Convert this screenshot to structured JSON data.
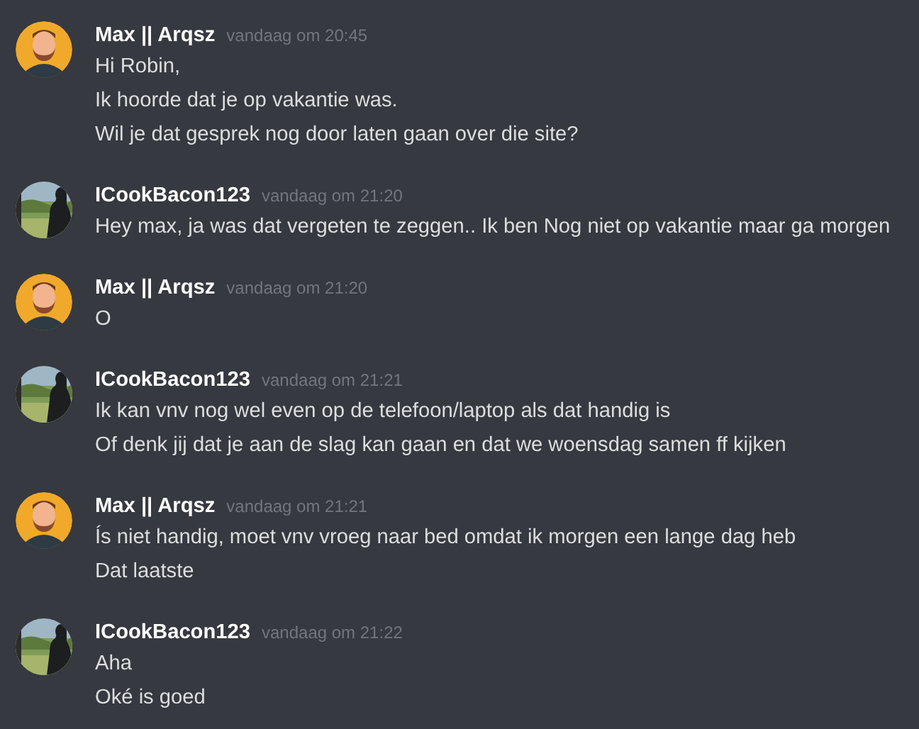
{
  "messages": [
    {
      "author": "Max || Arqsz",
      "avatar": {
        "kind": "cartoon"
      },
      "timestamp": "vandaag om 20:45",
      "lines": [
        "Hi Robin,",
        "Ik hoorde dat je op vakantie was.",
        "Wil je dat gesprek nog door laten gaan over die site?"
      ]
    },
    {
      "author": "ICookBacon123",
      "avatar": {
        "kind": "picture"
      },
      "timestamp": "vandaag om 21:20",
      "lines": [
        "Hey max, ja was dat vergeten te zeggen.. Ik ben Nog niet op vakantie maar ga morgen"
      ]
    },
    {
      "author": "Max || Arqsz",
      "avatar": {
        "kind": "cartoon"
      },
      "timestamp": "vandaag om 21:20",
      "lines": [
        "O"
      ]
    },
    {
      "author": "ICookBacon123",
      "avatar": {
        "kind": "picture"
      },
      "timestamp": "vandaag om 21:21",
      "lines": [
        "Ik kan vnv nog wel even op de telefoon/laptop als dat handig is",
        "Of denk jij dat je aan de slag kan gaan en dat we woensdag samen ff kijken"
      ]
    },
    {
      "author": "Max || Arqsz",
      "avatar": {
        "kind": "cartoon"
      },
      "timestamp": "vandaag om 21:21",
      "lines": [
        "Ís niet handig, moet vnv vroeg naar bed omdat ik morgen een lange dag heb",
        "Dat laatste"
      ]
    },
    {
      "author": "ICookBacon123",
      "avatar": {
        "kind": "picture"
      },
      "timestamp": "vandaag om 21:22",
      "lines": [
        "Aha",
        "Oké is goed"
      ]
    }
  ]
}
